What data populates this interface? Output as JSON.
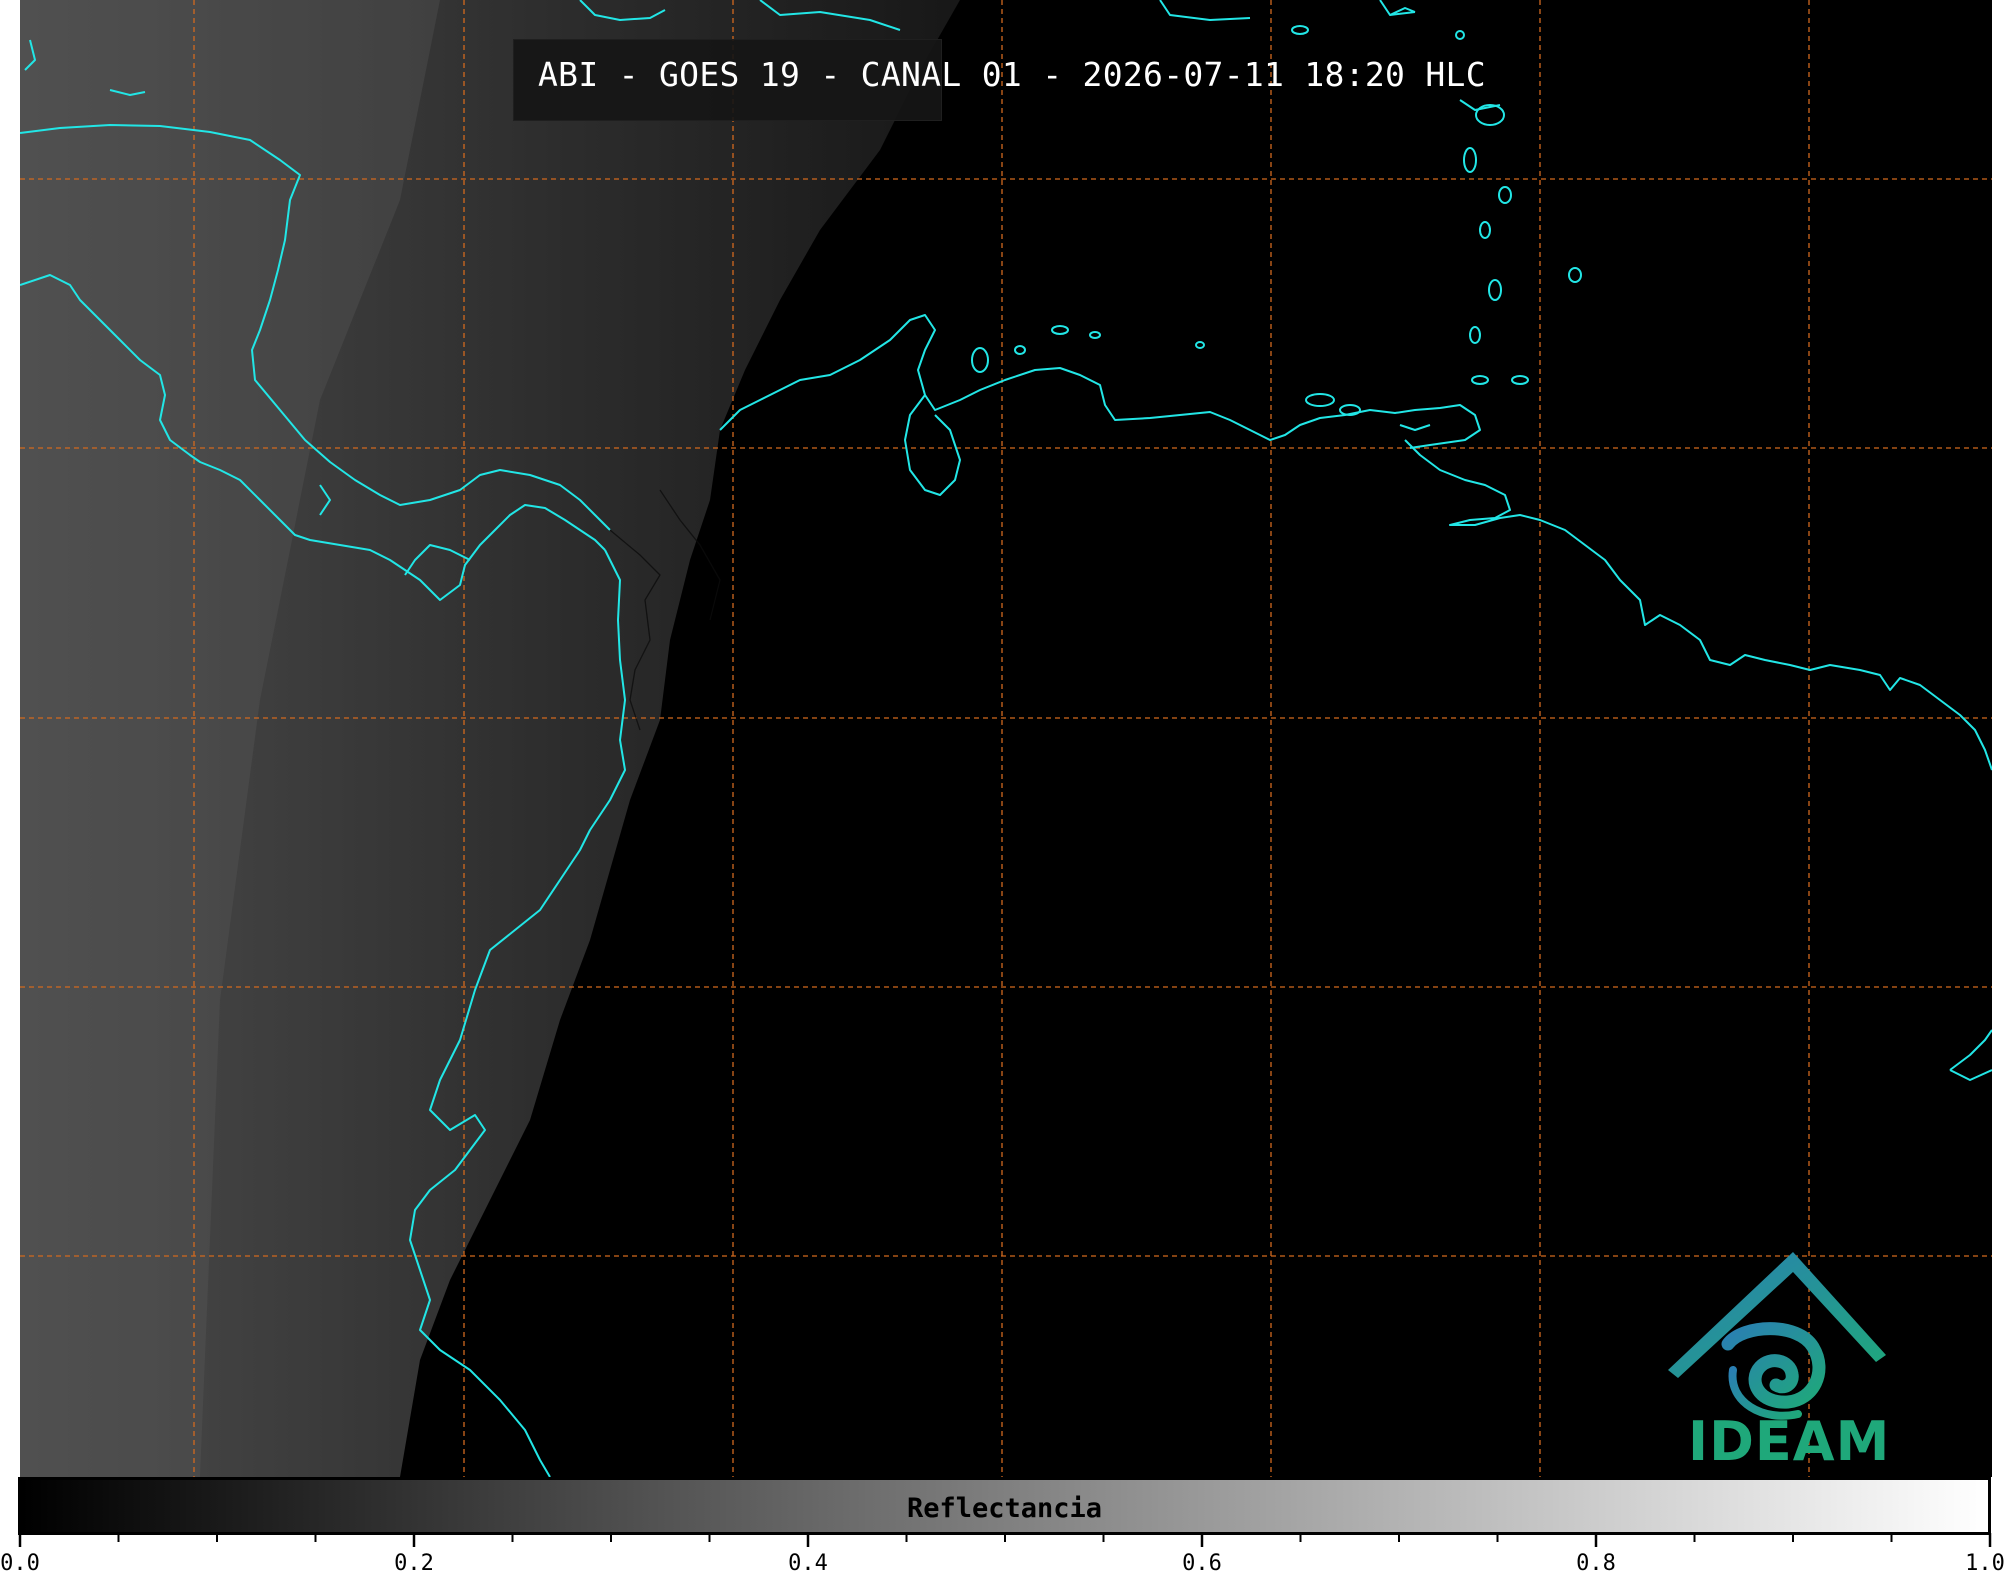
{
  "title": "ABI - GOES 19 - CANAL 01 - 2026-07-11 18:20 HLC",
  "colors": {
    "coastline": "#22e6e6",
    "gridlines": "#d2691e",
    "logo_text": "#1fa87a",
    "logo_roof": "#2a7fb3"
  },
  "logo": {
    "text": "IDEAM"
  },
  "colorbar": {
    "label": "Reflectancia",
    "range": [
      0.0,
      1.0
    ],
    "colormap": "grayscale black-to-white",
    "tick_labels": [
      "0.0",
      "0.2",
      "0.4",
      "0.6",
      "0.8",
      "1.0"
    ]
  }
}
